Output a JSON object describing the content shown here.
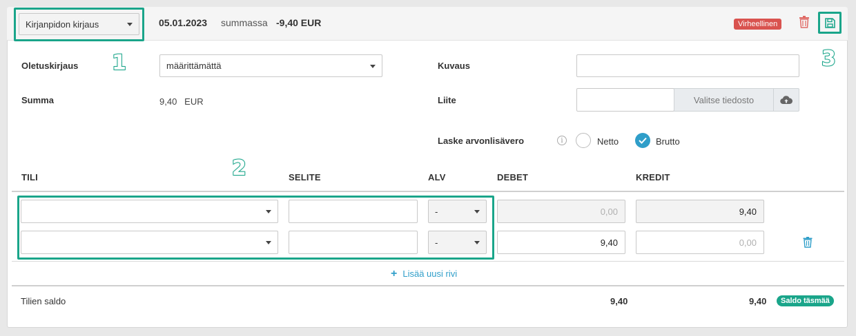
{
  "header": {
    "type_select": "Kirjanpidon kirjaus",
    "date": "05.01.2023",
    "sum_word": "summassa",
    "sum_value": "-9,40 EUR",
    "status_badge": "Virheellinen",
    "status_color": "#d9534f"
  },
  "form": {
    "default_entry_label": "Oletuskirjaus",
    "default_entry_value": "määrittämättä",
    "sum_label": "Summa",
    "sum_amount": "9,40",
    "sum_currency": "EUR",
    "description_label": "Kuvaus",
    "description_value": "",
    "attachment_label": "Liite",
    "attachment_value": "",
    "choose_file_label": "Valitse tiedosto",
    "vat_label": "Laske arvonlisävero",
    "vat_options": [
      "Netto",
      "Brutto"
    ],
    "vat_selected": "Brutto"
  },
  "table": {
    "columns": [
      "TILI",
      "SELITE",
      "ALV",
      "DEBET",
      "KREDIT"
    ],
    "rows": [
      {
        "account": "",
        "description": "",
        "vat": "-",
        "debit": "0,00",
        "credit": "9,40"
      },
      {
        "account": "",
        "description": "",
        "vat": "-",
        "debit": "9,40",
        "credit": "0,00"
      }
    ],
    "add_row_label": "Lisää uusi rivi"
  },
  "footer": {
    "balance_label": "Tilien saldo",
    "debit_total": "9,40",
    "credit_total": "9,40",
    "balance_badge": "Saldo täsmää",
    "balance_color": "#1aa58a"
  },
  "annotations": [
    "1",
    "2",
    "3"
  ],
  "accent": "#1aa58a"
}
